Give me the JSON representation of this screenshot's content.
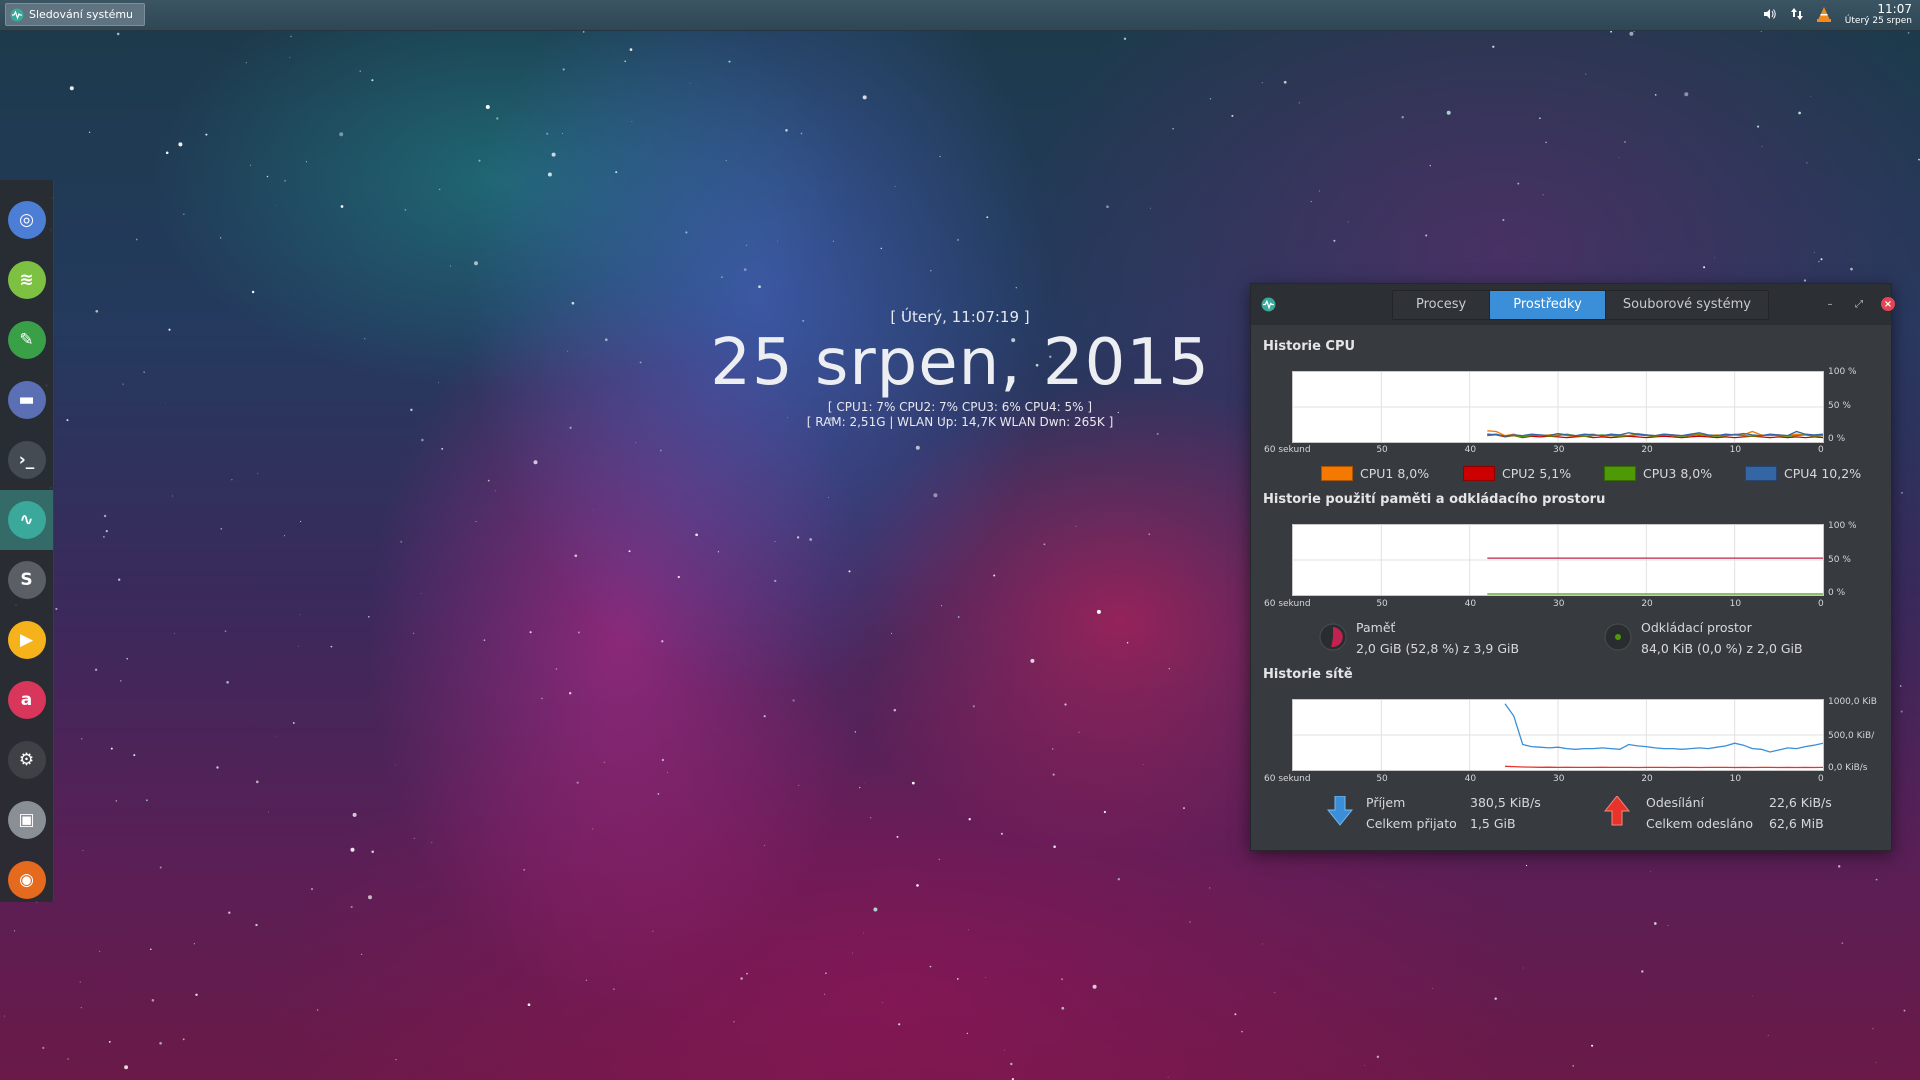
{
  "top_panel": {
    "task_title": "Sledování systému",
    "clock_time": "11:07",
    "clock_date": "Úterý 25 srpen",
    "tray_icons": [
      "volume-icon",
      "network-icon",
      "vlc-icon"
    ]
  },
  "dock": {
    "items": [
      {
        "name": "chromium",
        "color": "#4d7ed6"
      },
      {
        "name": "spotify",
        "color": "#7cc142"
      },
      {
        "name": "evernote",
        "color": "#3aa047"
      },
      {
        "name": "files",
        "color": "#5b6fb5"
      },
      {
        "name": "terminal",
        "color": "#444b52"
      },
      {
        "name": "system-monitor",
        "color": "#3aa89a"
      },
      {
        "name": "sublime-text",
        "color": "#5a5f66"
      },
      {
        "name": "media-player",
        "color": "#f6b21b"
      },
      {
        "name": "app-red",
        "color": "#d8365b"
      },
      {
        "name": "steam",
        "color": "#3e4247"
      },
      {
        "name": "truck-simulator",
        "color": "#8a8f96"
      },
      {
        "name": "firefox",
        "color": "#e66a1e"
      }
    ]
  },
  "conky": {
    "line1": "[ Úterý, 11:07:19 ]",
    "date": "25 srpen, 2015",
    "cpu_line": "[ CPU1: 7% CPU2: 7% CPU3: 6% CPU4: 5% ]",
    "mem_line": "[ RAM: 2,51G | WLAN Up: 14,7K WLAN Dwn: 265K ]"
  },
  "window": {
    "tabs": [
      "Procesy",
      "Prostředky",
      "Souborové systémy"
    ],
    "active_tab": 1,
    "cpu": {
      "title": "Historie CPU",
      "y_labels": [
        "100 %",
        "50 %",
        "0 %"
      ],
      "x_labels": [
        "60 sekund",
        "50",
        "40",
        "30",
        "20",
        "10",
        "0"
      ],
      "legend": [
        {
          "label": "CPU1",
          "value": "8,0%",
          "color": "#f57900"
        },
        {
          "label": "CPU2",
          "value": "5,1%",
          "color": "#cc0000"
        },
        {
          "label": "CPU3",
          "value": "8,0%",
          "color": "#4e9a06"
        },
        {
          "label": "CPU4",
          "value": "10,2%",
          "color": "#3465a4"
        }
      ]
    },
    "memory": {
      "title": "Historie použití paměti a odkládacího prostoru",
      "y_labels": [
        "100 %",
        "50 %",
        "0 %"
      ],
      "x_labels": [
        "60 sekund",
        "50",
        "40",
        "30",
        "20",
        "10",
        "0"
      ],
      "mem_label": "Paměť",
      "mem_value": "2,0 GiB (52,8 %) z 3,9 GiB",
      "mem_color": "#c1224f",
      "swap_label": "Odkládací prostor",
      "swap_value": "84,0 KiB (0,0 %) z 2,0 GiB",
      "swap_color": "#4e9a06"
    },
    "network": {
      "title": "Historie sítě",
      "y_labels": [
        "1000,0 KiB",
        "500,0 KiB/",
        "0,0 KiB/s"
      ],
      "x_labels": [
        "60 sekund",
        "50",
        "40",
        "30",
        "20",
        "10",
        "0"
      ],
      "rx_label": "Příjem",
      "rx_value": "380,5 KiB/s",
      "rx_total_label": "Celkem přijato",
      "rx_total_value": "1,5 GiB",
      "tx_label": "Odesílání",
      "tx_value": "22,6 KiB/s",
      "tx_total_label": "Celkem odesláno",
      "tx_total_value": "62,6 MiB",
      "rx_color": "#3a8fd8",
      "tx_color": "#e8332a"
    }
  },
  "chart_data": [
    {
      "type": "line",
      "title": "Historie CPU",
      "x": [
        38,
        37,
        36,
        35,
        34,
        33,
        32,
        31,
        30,
        29,
        28,
        27,
        26,
        25,
        24,
        23,
        22,
        21,
        20,
        19,
        18,
        17,
        16,
        15,
        14,
        13,
        12,
        11,
        10,
        9,
        8,
        7,
        6,
        5,
        4,
        3,
        2,
        1,
        0
      ],
      "ylim": [
        0,
        100
      ],
      "series": [
        {
          "name": "CPU1",
          "values": [
            15,
            14,
            8,
            10,
            6,
            9,
            8,
            9,
            10,
            8,
            7,
            9,
            10,
            7,
            8,
            9,
            8,
            11,
            9,
            8,
            10,
            9,
            8,
            9,
            10,
            8,
            9,
            8,
            10,
            9,
            14,
            9,
            8,
            9,
            8,
            10,
            9,
            8,
            8
          ]
        },
        {
          "name": "CPU2",
          "values": [
            10,
            9,
            6,
            8,
            5,
            7,
            6,
            7,
            6,
            5,
            6,
            7,
            5,
            6,
            5,
            6,
            7,
            6,
            5,
            6,
            7,
            6,
            5,
            6,
            7,
            6,
            5,
            6,
            5,
            6,
            7,
            6,
            5,
            6,
            5,
            6,
            5,
            6,
            5
          ]
        },
        {
          "name": "CPU3",
          "values": [
            8,
            9,
            7,
            8,
            6,
            8,
            9,
            7,
            8,
            10,
            8,
            7,
            8,
            9,
            8,
            7,
            8,
            9,
            8,
            7,
            9,
            8,
            7,
            8,
            9,
            8,
            7,
            8,
            9,
            8,
            7,
            8,
            9,
            8,
            7,
            8,
            9,
            7,
            8
          ]
        },
        {
          "name": "CPU4",
          "values": [
            9,
            10,
            7,
            9,
            8,
            10,
            9,
            8,
            11,
            9,
            8,
            10,
            9,
            8,
            10,
            9,
            12,
            10,
            9,
            8,
            10,
            9,
            8,
            10,
            12,
            9,
            8,
            10,
            9,
            11,
            9,
            8,
            10,
            9,
            8,
            14,
            10,
            9,
            10
          ]
        }
      ]
    },
    {
      "type": "line",
      "title": "Historie použití paměti a odkládacího prostoru",
      "x": [
        38,
        0
      ],
      "ylim": [
        0,
        100
      ],
      "series": [
        {
          "name": "Paměť",
          "values": [
            52.8,
            52.8
          ]
        },
        {
          "name": "Odkládací prostor",
          "values": [
            0,
            0
          ]
        }
      ]
    },
    {
      "type": "line",
      "title": "Historie sítě",
      "x": [
        36,
        35,
        34,
        33,
        32,
        31,
        30,
        29,
        28,
        27,
        26,
        25,
        24,
        23,
        22,
        21,
        20,
        19,
        18,
        17,
        16,
        15,
        14,
        13,
        12,
        11,
        10,
        9,
        8,
        7,
        6,
        5,
        4,
        3,
        2,
        1,
        0
      ],
      "ylim": [
        0,
        1000
      ],
      "series": [
        {
          "name": "Příjem",
          "values": [
            960,
            780,
            360,
            330,
            320,
            310,
            320,
            300,
            290,
            300,
            300,
            310,
            300,
            290,
            360,
            340,
            330,
            310,
            300,
            300,
            290,
            300,
            310,
            300,
            320,
            340,
            380,
            350,
            300,
            290,
            250,
            280,
            310,
            300,
            330,
            350,
            380
          ]
        },
        {
          "name": "Odesílání",
          "values": [
            40,
            35,
            30,
            28,
            25,
            26,
            24,
            25,
            24,
            23,
            24,
            25,
            24,
            23,
            24,
            22,
            23,
            24,
            23,
            22,
            24,
            23,
            22,
            23,
            24,
            23,
            22,
            23,
            22,
            24,
            23,
            22,
            23,
            22,
            23,
            22,
            23
          ]
        }
      ]
    }
  ]
}
